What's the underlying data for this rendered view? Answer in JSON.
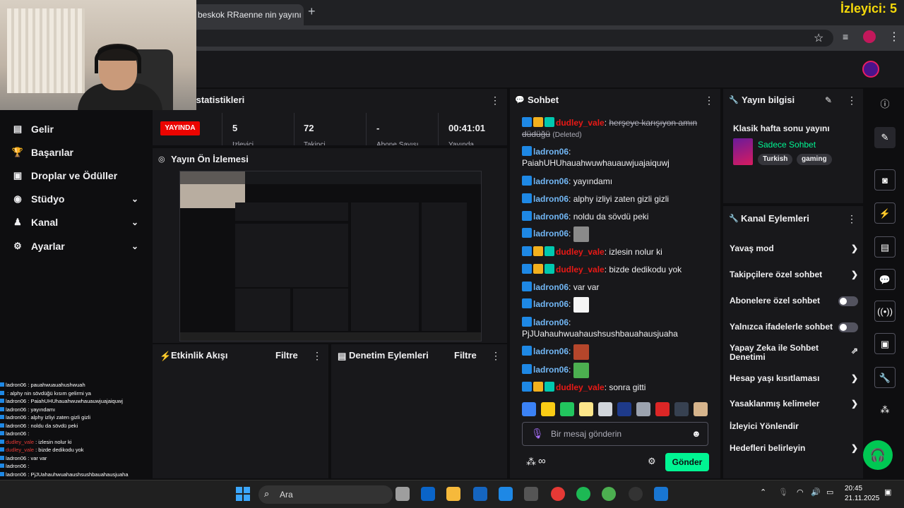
{
  "browser": {
    "tab_title": "beskok RRaenne nin yayını",
    "tab_close": "×",
    "new_tab": "+",
    "viewer_overlay": "İzleyici: 5"
  },
  "nav": {
    "items": [
      {
        "label": "Gelir",
        "icon": "revenue-icon",
        "glyph": "▤"
      },
      {
        "label": "Başarılar",
        "icon": "trophy-icon",
        "glyph": "🏆"
      },
      {
        "label": "Droplar ve Ödüller",
        "icon": "gift-icon",
        "glyph": "▣"
      },
      {
        "label": "Stüdyo",
        "icon": "studio-icon",
        "glyph": "◉",
        "chevron": "⌄"
      },
      {
        "label": "Kanal",
        "icon": "user-icon",
        "glyph": "♟",
        "chevron": "⌄"
      },
      {
        "label": "Ayarlar",
        "icon": "gear-icon",
        "glyph": "⚙",
        "chevron": "⌄"
      }
    ]
  },
  "chat_overlay": [
    {
      "user": "ladron06",
      "text": "pauahwuauahushwuah"
    },
    {
      "user": "",
      "text": "alphy nin sövdüğü kısım gelirmi ya"
    },
    {
      "user": "ladron06",
      "text": "PaiahUHUhauahwuwhauauwjuajaiquwj"
    },
    {
      "user": "ladron06",
      "text": "yayındamı"
    },
    {
      "user": "ladron06",
      "text": "alphy izliyi zaten gizli gizli"
    },
    {
      "user": "ladron06",
      "text": "noldu da sövdü peki"
    },
    {
      "user": "ladron06",
      "text": ""
    },
    {
      "user": "dudley_vale",
      "text": "izlesin nolur ki",
      "red": true
    },
    {
      "user": "dudley_vale",
      "text": "bizde dedikodu yok",
      "red": true
    },
    {
      "user": "ladron06",
      "text": "var var"
    },
    {
      "user": "ladron06",
      "text": ""
    },
    {
      "user": "ladron06",
      "text": "PjJUahauhwuahaushsushbauahausjuaha"
    },
    {
      "user": "ladron06",
      "text": ""
    },
    {
      "user": "ladron06",
      "text": ""
    },
    {
      "user": "dudley_vale",
      "text": "sonra gitti",
      "red": true
    }
  ],
  "stats": {
    "title": "İstatistikleri",
    "live": "YAYINDA",
    "viewers": "5",
    "viewers_label": "İzleyici",
    "followers": "72",
    "followers_label": "Takipçi",
    "subs": "-",
    "subs_label": "Abone Sayısı",
    "uptime": "00:41:01",
    "uptime_label": "Yayında"
  },
  "preview": {
    "title": "Yayın Ön İzlemesi"
  },
  "activity": {
    "title": "Etkinlik Akışı",
    "filter": "Filtre"
  },
  "mod_actions": {
    "title": "Denetim Eylemleri",
    "filter": "Filtre"
  },
  "chat": {
    "title": "Sohbet",
    "messages": [
      {
        "user": "dudley_vale",
        "red": true,
        "badges": 3,
        "text": "herşeye karışıyon amın düdüğü",
        "deleted": true,
        "suffix": "(Deleted)"
      },
      {
        "user": "ladron06",
        "badges": 1,
        "text": "PaiahUHUhauahwuwhauauwjuajaiquwj",
        "wrap": true
      },
      {
        "user": "ladron06",
        "badges": 1,
        "text": "yayındamı"
      },
      {
        "user": "ladron06",
        "badges": 1,
        "text": "alphy izliyi zaten gizli gizli"
      },
      {
        "user": "ladron06",
        "badges": 1,
        "text": "noldu da sövdü peki"
      },
      {
        "user": "ladron06",
        "badges": 1,
        "text": "",
        "emote": "#8a8a8a"
      },
      {
        "user": "dudley_vale",
        "red": true,
        "badges": 3,
        "text": "izlesin nolur ki"
      },
      {
        "user": "dudley_vale",
        "red": true,
        "badges": 3,
        "text": "bizde dedikodu yok"
      },
      {
        "user": "ladron06",
        "badges": 1,
        "text": "var var"
      },
      {
        "user": "ladron06",
        "badges": 1,
        "text": "",
        "emote": "#f5f5f5"
      },
      {
        "user": "ladron06",
        "badges": 1,
        "text": "PjJUahauhwuahaushsushbauahausjuaha",
        "wrap": true
      },
      {
        "user": "ladron06",
        "badges": 1,
        "text": "",
        "emote": "#b5462b"
      },
      {
        "user": "ladron06",
        "badges": 1,
        "text": "",
        "emote": "#4caf50"
      },
      {
        "user": "dudley_vale",
        "red": true,
        "badges": 3,
        "text": "sonra gitti"
      }
    ],
    "emote_colors": [
      "#3b82f6",
      "#facc15",
      "#22c55e",
      "#fde68a",
      "#d1d5db",
      "#1e3a8a",
      "#9ca3af",
      "#dc2626",
      "#374151",
      "#d6b48c"
    ],
    "placeholder": "Bir mesaj gönderin",
    "bits": "∞",
    "send": "Gönder"
  },
  "stream_info": {
    "title": "Yayın bilgisi",
    "stream_title": "Klasik hafta sonu yayını",
    "category": "Sadece Sohbet",
    "tags": [
      "Turkish",
      "gaming"
    ]
  },
  "channel_actions": {
    "title": "Kanal Eylemleri",
    "items": [
      {
        "label": "Yavaş mod",
        "control": "chevron"
      },
      {
        "label": "Takipçilere özel sohbet",
        "control": "chevron"
      },
      {
        "label": "Abonelere özel sohbet",
        "control": "toggle"
      },
      {
        "label": "Yalnızca ifadelerle sohbet",
        "control": "toggle"
      },
      {
        "label": "Yapay Zeka ile Sohbet Denetimi",
        "control": "external"
      },
      {
        "label": "Hesap yaşı kısıtlaması",
        "control": "chevron"
      },
      {
        "label": "Yasaklanmış kelimeler",
        "control": "chevron"
      },
      {
        "label": "İzleyici Yönlendir",
        "control": "none"
      },
      {
        "label": "Hedefleri belirleyin",
        "control": "chevron"
      }
    ]
  },
  "taskbar": {
    "search": "Ara",
    "time": "20:45",
    "date": "21.11.2025"
  }
}
